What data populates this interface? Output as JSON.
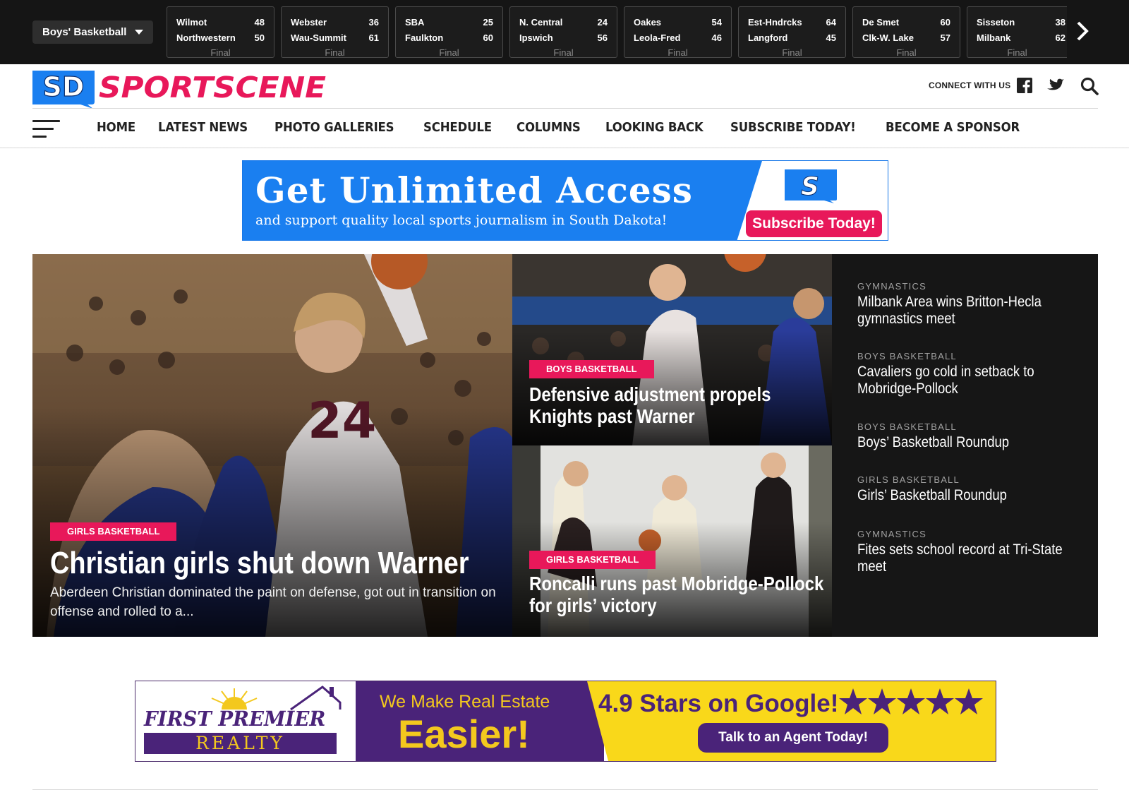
{
  "scores": {
    "sport_selector": "Boys' Basketball",
    "games": [
      {
        "team1": "Wilmot",
        "score1": "48",
        "team2": "Northwestern",
        "score2": "50",
        "status": "Final"
      },
      {
        "team1": "Webster",
        "score1": "36",
        "team2": "Wau-Summit",
        "score2": "61",
        "status": "Final"
      },
      {
        "team1": "SBA",
        "score1": "25",
        "team2": "Faulkton",
        "score2": "60",
        "status": "Final"
      },
      {
        "team1": "N. Central",
        "score1": "24",
        "team2": "Ipswich",
        "score2": "56",
        "status": "Final"
      },
      {
        "team1": "Oakes",
        "score1": "54",
        "team2": "Leola-Fred",
        "score2": "46",
        "status": "Final"
      },
      {
        "team1": "Est-Hndrcks",
        "score1": "64",
        "team2": "Langford",
        "score2": "45",
        "status": "Final"
      },
      {
        "team1": "De Smet",
        "score1": "60",
        "team2": "Clk-W. Lake",
        "score2": "57",
        "status": "Final"
      },
      {
        "team1": "Sisseton",
        "score1": "38",
        "team2": "Milbank",
        "score2": "62",
        "status": "Final"
      }
    ],
    "next_icon": "chevron-right-icon"
  },
  "header": {
    "logo_badge": "SD",
    "logo_text": "SPORTSCENE",
    "connect_label": "CONNECT WITH US",
    "icons": [
      "facebook-icon",
      "twitter-icon",
      "search-icon"
    ]
  },
  "nav": {
    "menu_icon": "hamburger-icon",
    "items": [
      "HOME",
      "LATEST NEWS",
      "PHOTO GALLERIES",
      "SCHEDULE",
      "COLUMNS",
      "LOOKING BACK",
      "SUBSCRIBE TODAY!",
      "BECOME A SPONSOR"
    ]
  },
  "ad_top": {
    "headline": "Get Unlimited Access",
    "subline": "and support quality local sports journalism in South Dakota!",
    "badge": "S",
    "cta": "Subscribe Today!"
  },
  "feature": {
    "main": {
      "category": "GIRLS BASKETBALL",
      "title": "Christian girls shut down Warner",
      "excerpt": "Aberdeen Christian dominated the paint on defense, got out in transition on offense and rolled to a..."
    },
    "top_right": {
      "category": "BOYS BASKETBALL",
      "title_line1": "Defensive adjustment propels",
      "title_line2": "Knights past Warner"
    },
    "bottom_right": {
      "category": "GIRLS BASKETBALL",
      "title_line1": "Roncalli runs past Mobridge-Pollock",
      "title_line2": "for girls’ victory"
    },
    "sidebar": [
      {
        "category": "GYMNASTICS",
        "title": "Milbank Area wins Britton-Hecla gymnastics meet"
      },
      {
        "category": "BOYS BASKETBALL",
        "title": "Cavaliers go cold in setback to Mobridge-Pollock"
      },
      {
        "category": "BOYS BASKETBALL",
        "title": "Boys’ Basketball Roundup"
      },
      {
        "category": "GIRLS BASKETBALL",
        "title": "Girls’ Basketball Roundup"
      },
      {
        "category": "GYMNASTICS",
        "title": "Fites sets school record at Tri-State meet"
      }
    ]
  },
  "ad_bottom": {
    "brand_name": "FIRST PREMIER",
    "brand_sub": "REALTY",
    "tagline1": "We Make Real Estate",
    "tagline2": "Easier!",
    "rating": "4.9 Stars on Google!",
    "stars": 5,
    "cta": "Talk to an Agent Today!"
  },
  "colors": {
    "accent": "#e8185a",
    "brand_blue": "#1a7ff0",
    "dark_bar": "#151515",
    "realty_purple": "#4a2379",
    "realty_yellow": "#f3c81e"
  }
}
